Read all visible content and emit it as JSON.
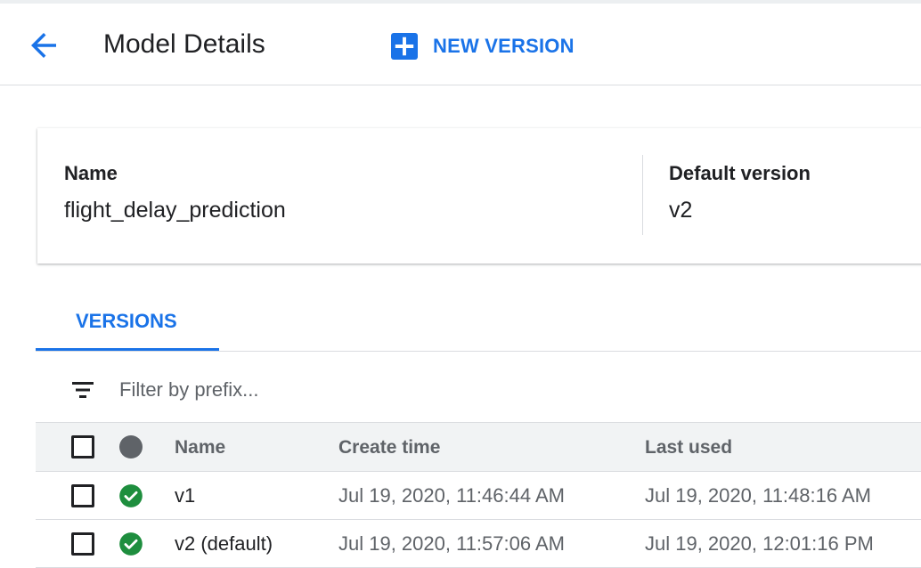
{
  "header": {
    "title": "Model Details",
    "back_icon": "arrow-left-icon",
    "new_version_label": "NEW VERSION",
    "new_version_icon": "plus-box-icon"
  },
  "details": {
    "name_label": "Name",
    "name_value": "flight_delay_prediction",
    "default_version_label": "Default version",
    "default_version_value": "v2"
  },
  "tabs": [
    {
      "label": "VERSIONS",
      "active": true
    }
  ],
  "filter": {
    "icon": "filter-list-icon",
    "placeholder": "Filter by prefix...",
    "value": ""
  },
  "table": {
    "columns": [
      "Name",
      "Create time",
      "Last used"
    ],
    "rows": [
      {
        "name": "v1",
        "create_time": "Jul 19, 2020, 11:46:44 AM",
        "last_used": "Jul 19, 2020, 11:48:16 AM",
        "status": "ok",
        "selected": false
      },
      {
        "name": "v2 (default)",
        "create_time": "Jul 19, 2020, 11:57:06 AM",
        "last_used": "Jul 19, 2020, 12:01:16 PM",
        "status": "ok",
        "selected": false
      }
    ]
  },
  "colors": {
    "accent": "#1a73e8",
    "success": "#1e8e3e",
    "text": "#202124",
    "muted": "#5f6368",
    "header_row_bg": "#f1f3f4"
  }
}
